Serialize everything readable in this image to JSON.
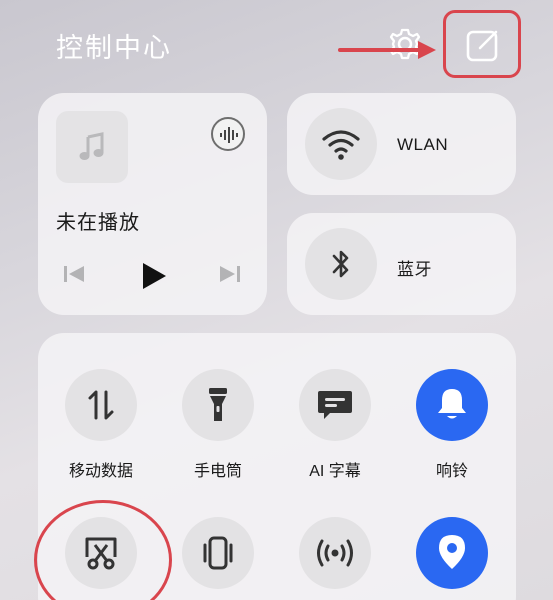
{
  "header": {
    "title": "控制中心",
    "settings_icon": "gear-icon",
    "edit_icon": "edit-icon"
  },
  "media": {
    "status": "未在播放",
    "album_icon": "music-note-icon",
    "sound_icon": "audio-output-icon"
  },
  "toggles": {
    "wlan_label": "WLAN",
    "bluetooth_label": "蓝牙"
  },
  "tiles": [
    {
      "label": "移动数据",
      "icon": "mobile-data-icon",
      "active": false
    },
    {
      "label": "手电筒",
      "icon": "flashlight-icon",
      "active": false
    },
    {
      "label": "AI 字幕",
      "icon": "subtitles-icon",
      "active": false
    },
    {
      "label": "响铃",
      "icon": "bell-icon",
      "active": true
    },
    {
      "label": "",
      "icon": "screenshot-icon",
      "active": false
    },
    {
      "label": "",
      "icon": "vibrate-icon",
      "active": false
    },
    {
      "label": "",
      "icon": "hotspot-icon",
      "active": false
    },
    {
      "label": "",
      "icon": "location-icon",
      "active": true
    }
  ],
  "colors": {
    "accent": "#2a68f2",
    "annotation": "#d9454d"
  }
}
